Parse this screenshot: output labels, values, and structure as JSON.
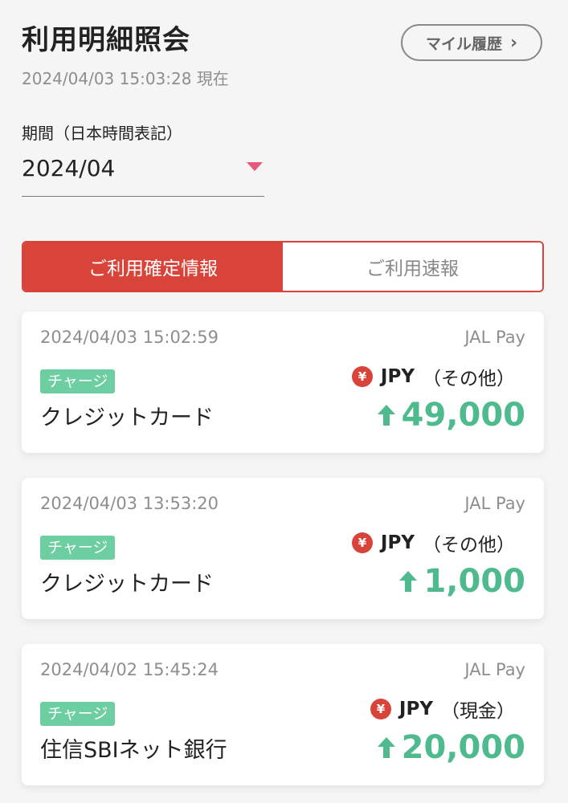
{
  "header": {
    "title": "利用明細照会",
    "mile_button_label": "マイル履歴",
    "as_of": "2024/04/03 15:03:28 現在"
  },
  "period": {
    "label": "期間（日本時間表記）",
    "value": "2024/04"
  },
  "tabs": [
    {
      "label": "ご利用確定情報",
      "active": true
    },
    {
      "label": "ご利用速報",
      "active": false
    }
  ],
  "transactions": [
    {
      "datetime": "2024/04/03 15:02:59",
      "pay": "JAL Pay",
      "badge": "チャージ",
      "name": "クレジットカード",
      "currency_icon": "¥",
      "currency_code": "JPY",
      "currency_note": "（その他）",
      "amount": "49,000"
    },
    {
      "datetime": "2024/04/03 13:53:20",
      "pay": "JAL Pay",
      "badge": "チャージ",
      "name": "クレジットカード",
      "currency_icon": "¥",
      "currency_code": "JPY",
      "currency_note": "（その他）",
      "amount": "1,000"
    },
    {
      "datetime": "2024/04/02 15:45:24",
      "pay": "JAL Pay",
      "badge": "チャージ",
      "name": "住信SBIネット銀行",
      "currency_icon": "¥",
      "currency_code": "JPY",
      "currency_note": "（現金）",
      "amount": "20,000"
    }
  ],
  "colors": {
    "accent_red": "#d8433a",
    "charge_green": "#6dcea2",
    "amount_green": "#4fba8d",
    "dropdown_pink": "#e8567a"
  }
}
